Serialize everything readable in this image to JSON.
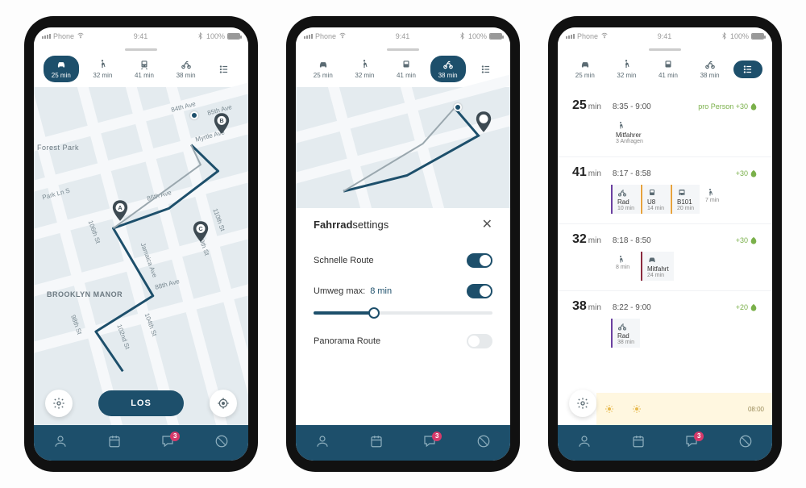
{
  "statusBar": {
    "carrier": "Phone",
    "time": "9:41",
    "batteryText": "100%"
  },
  "modes": [
    {
      "id": "car",
      "label": "25 min",
      "icon": "car"
    },
    {
      "id": "walk",
      "label": "32 min",
      "icon": "walk"
    },
    {
      "id": "transit",
      "label": "41 min",
      "icon": "train"
    },
    {
      "id": "bike",
      "label": "38 min",
      "icon": "bike"
    },
    {
      "id": "list",
      "label": "",
      "icon": "list"
    }
  ],
  "screen1": {
    "activeMode": "car",
    "map": {
      "streets": [
        "84th Ave",
        "85th Ave",
        "Myrtle Ave",
        "Park Ln S",
        "86th Ave",
        "106th St",
        "Jamaica Ave",
        "109th St",
        "110th St",
        "98th St",
        "88th Ave",
        "104th St",
        "102nd St"
      ],
      "areas": [
        "Forest Park",
        "BROOKLYN MANOR"
      ],
      "markers": [
        "A",
        "B",
        "C"
      ]
    },
    "goButton": "LOS"
  },
  "screen2": {
    "activeMode": "bike",
    "sheet": {
      "titleBold": "Fahrrad",
      "titleLight": "settings",
      "rows": {
        "fastRoute": {
          "label": "Schnelle Route",
          "on": true
        },
        "detour": {
          "label": "Umweg max:",
          "value": "8 min",
          "on": true
        },
        "panorama": {
          "label": "Panorama Route",
          "on": false
        }
      }
    }
  },
  "screen3": {
    "activeMode": "list",
    "results": [
      {
        "mins": "25",
        "minsUnit": "min",
        "time": "8:35 - 9:00",
        "extraLabel": "pro Person +30",
        "segments": [
          {
            "icon": "walk",
            "name": "Mitfahrer",
            "sub": "3 Anfragen",
            "border": "grey"
          }
        ]
      },
      {
        "mins": "41",
        "minsUnit": "min",
        "time": "8:17 - 8:58",
        "extraLabel": "+30",
        "segments": [
          {
            "icon": "bike",
            "name": "Rad",
            "sub": "10 min",
            "border": "purple"
          },
          {
            "icon": "train",
            "name": "U8",
            "sub": "14 min",
            "border": "orange"
          },
          {
            "icon": "bus",
            "name": "B101",
            "sub": "20 min",
            "border": "orange"
          },
          {
            "icon": "walk",
            "name": "",
            "sub": "7 min",
            "border": "grey"
          }
        ]
      },
      {
        "mins": "32",
        "minsUnit": "min",
        "time": "8:18 - 8:50",
        "extraLabel": "+30",
        "segments": [
          {
            "icon": "walk",
            "name": "",
            "sub": "8 min",
            "border": "grey"
          },
          {
            "icon": "car",
            "name": "Mitfahrt",
            "sub": "24 min",
            "border": "darkred"
          }
        ]
      },
      {
        "mins": "38",
        "minsUnit": "min",
        "time": "8:22 - 9:00",
        "extraLabel": "+20",
        "segments": [
          {
            "icon": "bike",
            "name": "Rad",
            "sub": "38 min",
            "border": "purple"
          }
        ],
        "weatherTime": "08:00"
      }
    ]
  },
  "bottomNav": {
    "badge": "3"
  }
}
